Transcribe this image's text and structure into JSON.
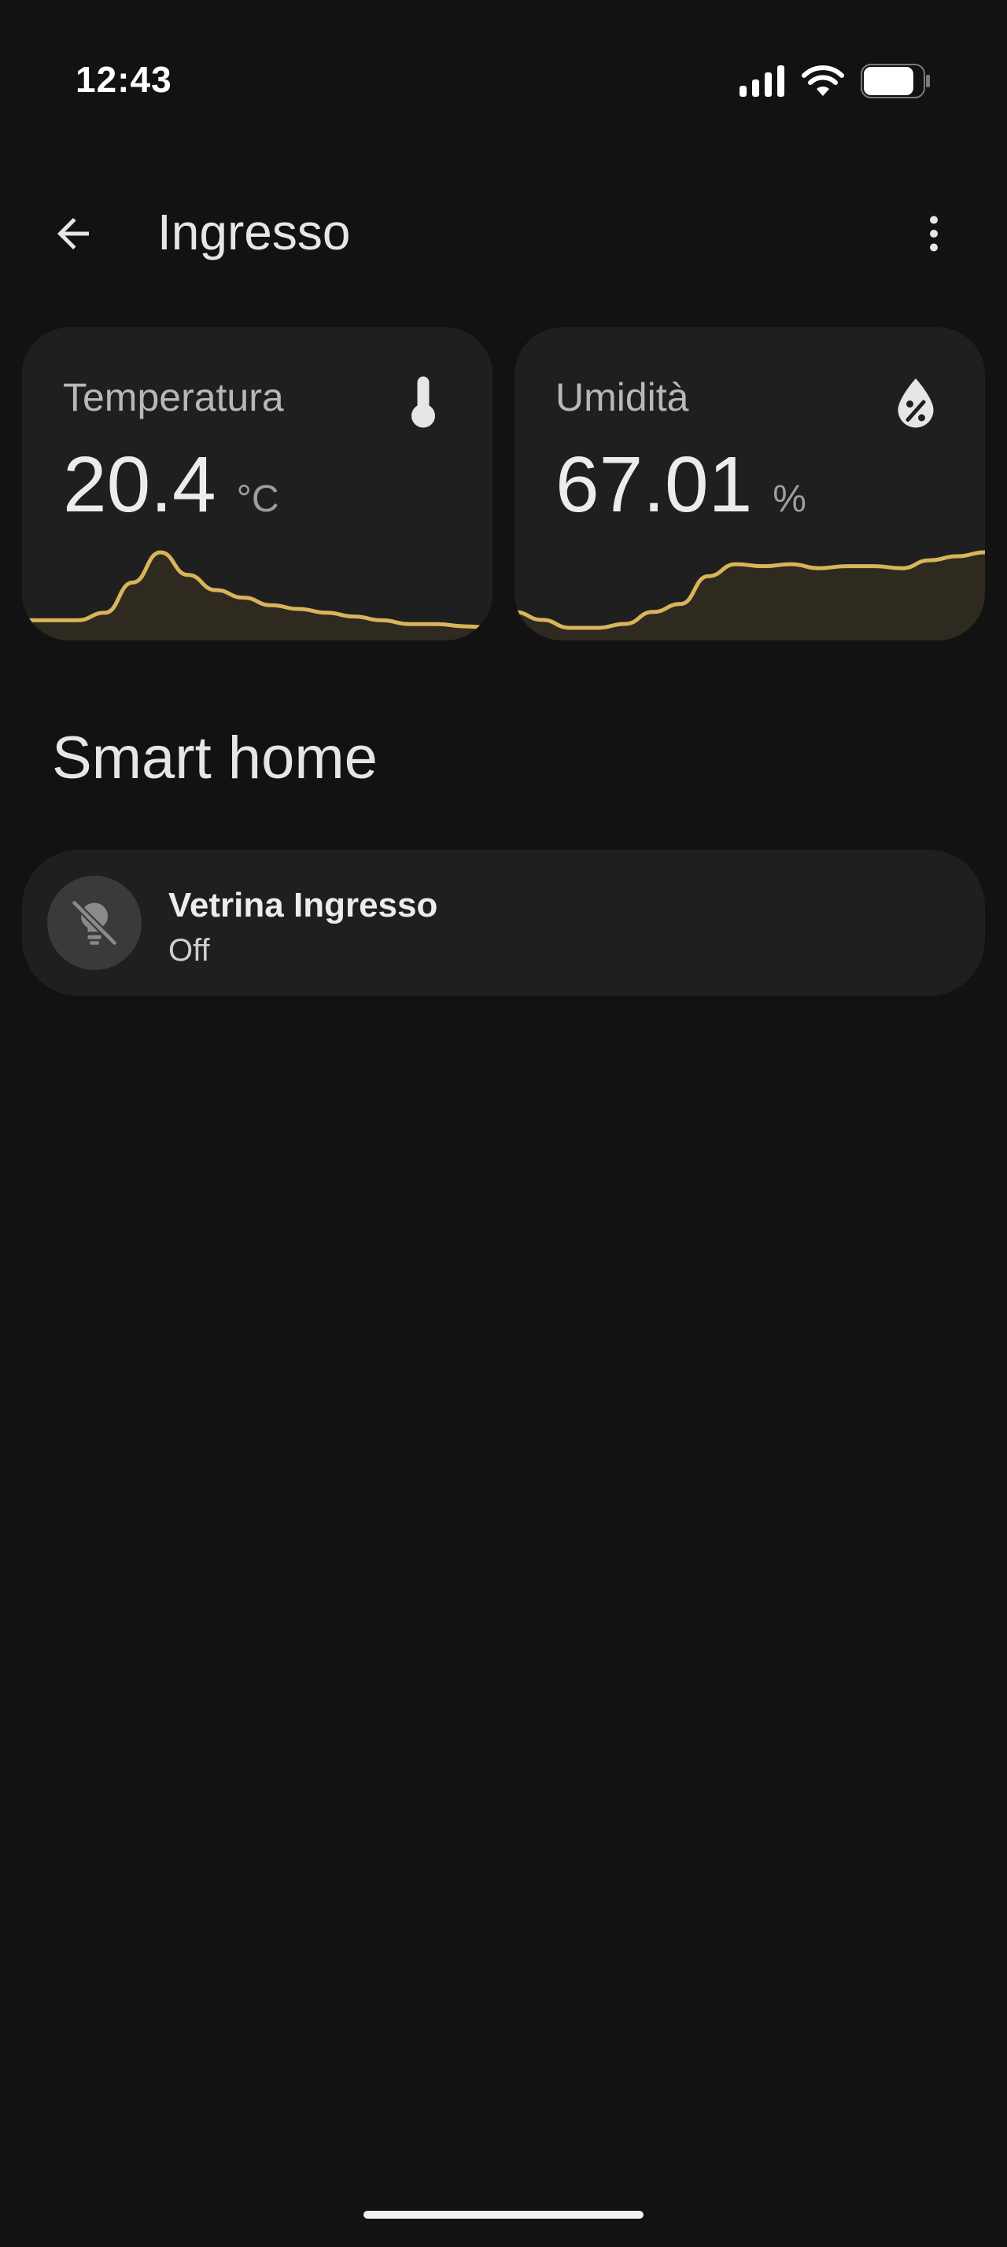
{
  "status_bar": {
    "time": "12:43",
    "icons": [
      "signal-icon",
      "wifi-icon",
      "battery-icon"
    ],
    "battery_level": 0.85
  },
  "app_bar": {
    "title": "Ingresso",
    "back_icon": "arrow-left-icon",
    "menu_icon": "more-vertical-icon"
  },
  "sensors": [
    {
      "label": "Temperatura",
      "value": "20.4",
      "unit": "°C",
      "icon": "thermometer-icon",
      "trend": [
        20.2,
        20.2,
        20.2,
        20.3,
        20.7,
        21.1,
        20.8,
        20.6,
        20.5,
        20.4,
        20.35,
        20.3,
        20.25,
        20.2,
        20.15,
        20.15,
        20.12,
        20.1
      ]
    },
    {
      "label": "Umidità",
      "value": "67.01",
      "unit": "%",
      "icon": "water-percent-icon",
      "trend": [
        65.6,
        65.4,
        65.2,
        65.2,
        65.3,
        65.6,
        65.8,
        66.5,
        66.8,
        66.75,
        66.8,
        66.7,
        66.75,
        66.75,
        66.7,
        66.9,
        67.0,
        67.1
      ]
    }
  ],
  "colors": {
    "background": "#121212",
    "card": "#1f1f1f",
    "accent": "#d9b45b",
    "accent_fill": "#2e2a20"
  },
  "section": {
    "title": "Smart home"
  },
  "device": {
    "name": "Vetrina Ingresso",
    "state": "Off",
    "icon": "lightbulb-off-icon"
  }
}
